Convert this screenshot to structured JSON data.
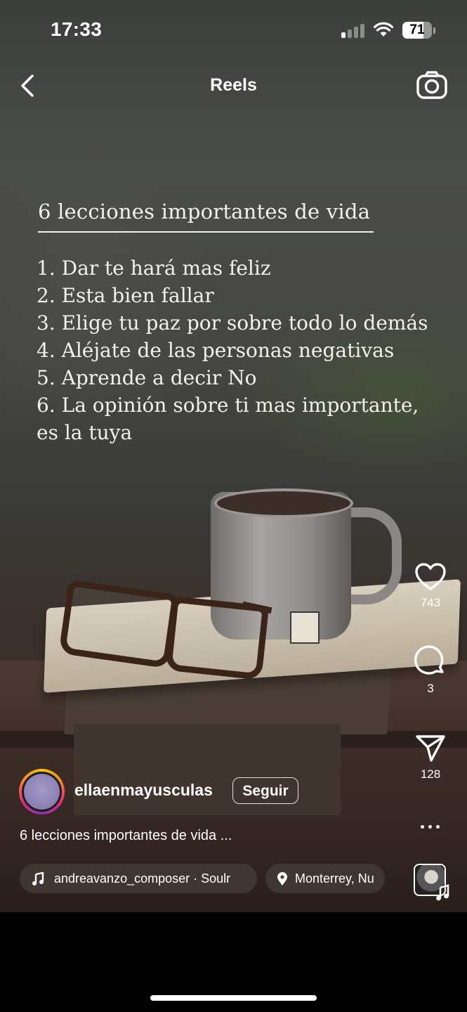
{
  "status_bar": {
    "time": "17:33",
    "battery": "71",
    "battery_level": 0.71
  },
  "header": {
    "title": "Reels",
    "back_icon": "chevron-left-icon",
    "camera_icon": "camera-icon"
  },
  "reel": {
    "overlay_title": "6 lecciones importantes de vida",
    "lessons": [
      "1. Dar te hará mas feliz",
      "2. Esta bien fallar",
      "3. Elige tu paz por sobre todo lo demás",
      "4. Aléjate de las personas negativas",
      "5. Aprende a decir No",
      "6. La opinión sobre ti mas importante,",
      "es la tuya"
    ]
  },
  "actions": {
    "likes": "743",
    "comments": "3",
    "shares": "128"
  },
  "author": {
    "username": "ellaenmayusculas",
    "follow_label": "Seguir"
  },
  "caption": "6 lecciones importantes de vida ...",
  "music": {
    "label": "andreavanzo_composer · Soulr"
  },
  "location": {
    "label": "Monterrey, Nu"
  }
}
